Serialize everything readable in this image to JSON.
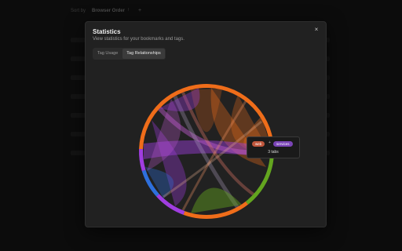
{
  "background": {
    "sort_label": "Sort by",
    "sort_value": "Browser Order",
    "arrow": "↑",
    "plus": "+"
  },
  "modal": {
    "title": "Statistics",
    "subtitle": "View statistics for your bookmarks and tags.",
    "close": "×",
    "tabs": [
      {
        "label": "Tag Usage",
        "active": false
      },
      {
        "label": "Tag Relationships",
        "active": true
      }
    ]
  },
  "tooltip": {
    "tag_a": "web",
    "tag_a_color": "#c0573d",
    "plus": "+",
    "tag_b": "services",
    "tag_b_color": "#7a44b6",
    "count": "3 tabs"
  },
  "chord": {
    "segments": [
      {
        "color": "#ef6d1a",
        "start": -88,
        "end": 92
      },
      {
        "color": "#63a51f",
        "start": 92,
        "end": 142
      },
      {
        "color": "#ef6d1a",
        "start": 142,
        "end": 200
      },
      {
        "color": "#a03de0",
        "start": 200,
        "end": 228
      },
      {
        "color": "#2e6fdc",
        "start": 228,
        "end": 253
      },
      {
        "color": "#a03de0",
        "start": 253,
        "end": 272
      }
    ]
  }
}
